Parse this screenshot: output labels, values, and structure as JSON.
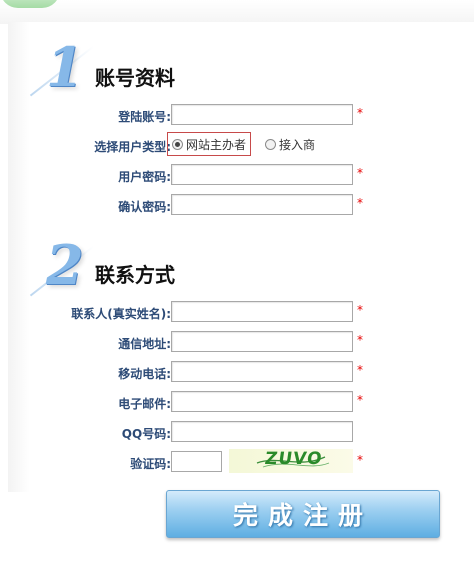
{
  "section1": {
    "number": "1",
    "title": "账号资料"
  },
  "section2": {
    "number": "2",
    "title": "联系方式"
  },
  "account": {
    "login_label": "登陆账号:",
    "user_type_label": "选择用户类型:",
    "user_type_options": [
      "网站主办者",
      "接入商"
    ],
    "selected_user_type": "网站主办者",
    "password_label": "用户密码:",
    "confirm_password_label": "确认密码:"
  },
  "contact": {
    "name_label": "联系人(真实姓名):",
    "address_label": "通信地址:",
    "mobile_label": "移动电话:",
    "email_label": "电子邮件:",
    "qq_label": "QQ号码:",
    "captcha_label": "验证码:",
    "captcha_text": "ZUVO"
  },
  "required_mark": "*",
  "submit_label": "完成注册",
  "colors": {
    "label": "#2d4b77",
    "required": "#e60000",
    "button_top": "#d4ebfb",
    "button_bottom": "#5eaee2"
  }
}
